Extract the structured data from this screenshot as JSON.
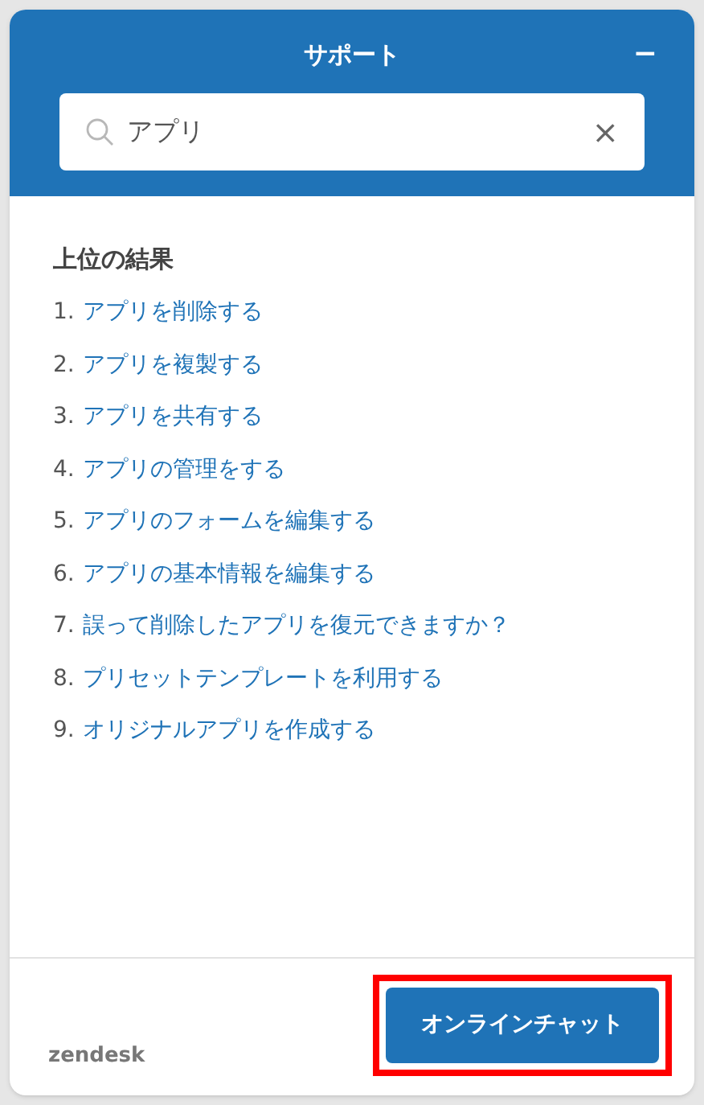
{
  "header": {
    "title": "サポート",
    "minimize": "−"
  },
  "search": {
    "value": "アプリ",
    "clear": "×"
  },
  "results": {
    "heading": "上位の結果",
    "items": [
      {
        "number": "1.",
        "label": "アプリを削除する"
      },
      {
        "number": "2.",
        "label": "アプリを複製する"
      },
      {
        "number": "3.",
        "label": "アプリを共有する"
      },
      {
        "number": "4.",
        "label": "アプリの管理をする"
      },
      {
        "number": "5.",
        "label": "アプリのフォームを編集する"
      },
      {
        "number": "6.",
        "label": "アプリの基本情報を編集する"
      },
      {
        "number": "7.",
        "label": "誤って削除したアプリを復元できますか？"
      },
      {
        "number": "8.",
        "label": "プリセットテンプレートを利用する"
      },
      {
        "number": "9.",
        "label": "オリジナルアプリを作成する"
      }
    ]
  },
  "footer": {
    "brand": "zendesk",
    "button": "オンラインチャット",
    "button_highlighted": true
  }
}
